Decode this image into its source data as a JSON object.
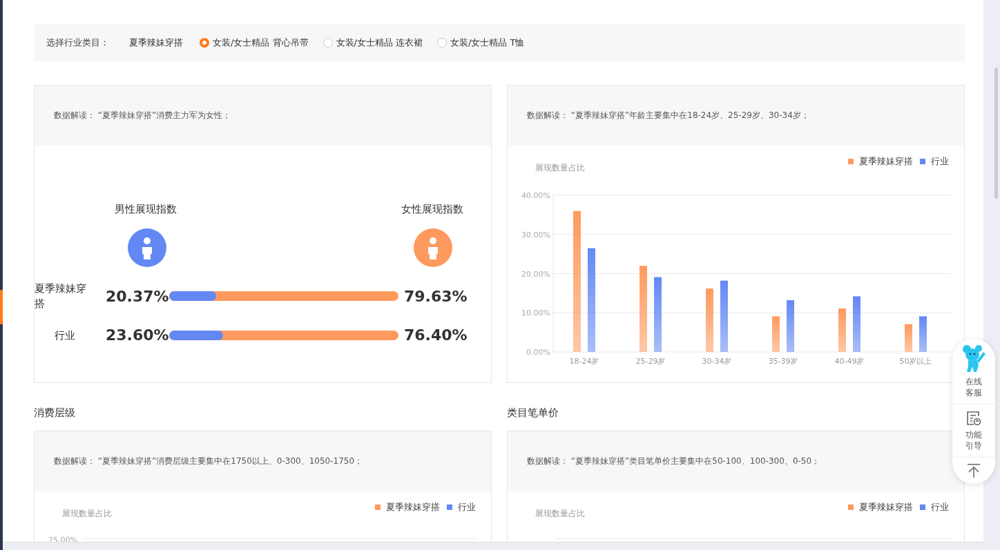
{
  "filter": {
    "label": "选择行业类目：",
    "keyword": "夏季辣妹穿搭",
    "options": [
      {
        "label": "女装/女士精品 背心吊带",
        "selected": true
      },
      {
        "label": "女装/女士精品 连衣裙",
        "selected": false
      },
      {
        "label": "女装/女士精品 T恤",
        "selected": false
      }
    ]
  },
  "gender_card": {
    "insight": "数据解读： “夏季辣妹穿搭”消费主力军为女性；",
    "male_title": "男性展现指数",
    "female_title": "女性展现指数",
    "rows": [
      {
        "name": "夏季辣妹穿搭",
        "male": "20.37%",
        "female": "79.63%",
        "level": 0.2037
      },
      {
        "name": "行业",
        "male": "23.60%",
        "female": "76.40%",
        "level": 0.236
      }
    ]
  },
  "age_card": {
    "insight": "数据解读： “夏季辣妹穿搭”年龄主要集中在18-24岁、25-29岁、30-34岁；",
    "chart_data": {
      "type": "bar",
      "ylabel": "展现数量占比",
      "categories": [
        "18-24岁",
        "25-29岁",
        "30-34岁",
        "35-39岁",
        "40-49岁",
        "50岁以上"
      ],
      "series": [
        {
          "name": "夏季辣妹穿搭",
          "color": "#fe9a5e",
          "values": [
            36,
            22,
            16.2,
            9.1,
            11.1,
            7.1
          ]
        },
        {
          "name": "行业",
          "color": "#6388f4",
          "values": [
            26.5,
            19.1,
            18.2,
            13.2,
            14.2,
            9.1
          ]
        }
      ],
      "grid": true,
      "legend": true,
      "ylim": [
        0,
        40
      ],
      "yticks": [
        {
          "value": 0,
          "label": "0.00%"
        },
        {
          "value": 10,
          "label": "10.00%"
        },
        {
          "value": 20,
          "label": "20.00%"
        },
        {
          "value": 30,
          "label": "30.00%"
        },
        {
          "value": 40,
          "label": "40.00%"
        }
      ]
    }
  },
  "sections": [
    {
      "title": "消费层级",
      "insight": "数据解读： “夏季辣妹穿搭”消费层级主要集中在1750以上、0-300、1050-1750；",
      "chart_title": "展现数量占比",
      "legend": [
        {
          "label": "夏季辣妹穿搭",
          "color": "#fe9a5e"
        },
        {
          "label": "行业",
          "color": "#6388f4"
        }
      ],
      "top_tick": "25.00%"
    },
    {
      "title": "类目笔单价",
      "insight": "数据解读： “夏季辣妹穿搭”类目笔单价主要集中在50-100、100-300、0-50；",
      "chart_title": "展现数量占比",
      "legend": [
        {
          "label": "夏季辣妹穿搭",
          "color": "#fe9a5e"
        },
        {
          "label": "行业",
          "color": "#6388f4"
        }
      ]
    }
  ],
  "helper": {
    "items": [
      {
        "kind": "service",
        "label": "在线客服"
      },
      {
        "kind": "guide",
        "label": "功能引导"
      },
      {
        "kind": "top"
      }
    ]
  }
}
